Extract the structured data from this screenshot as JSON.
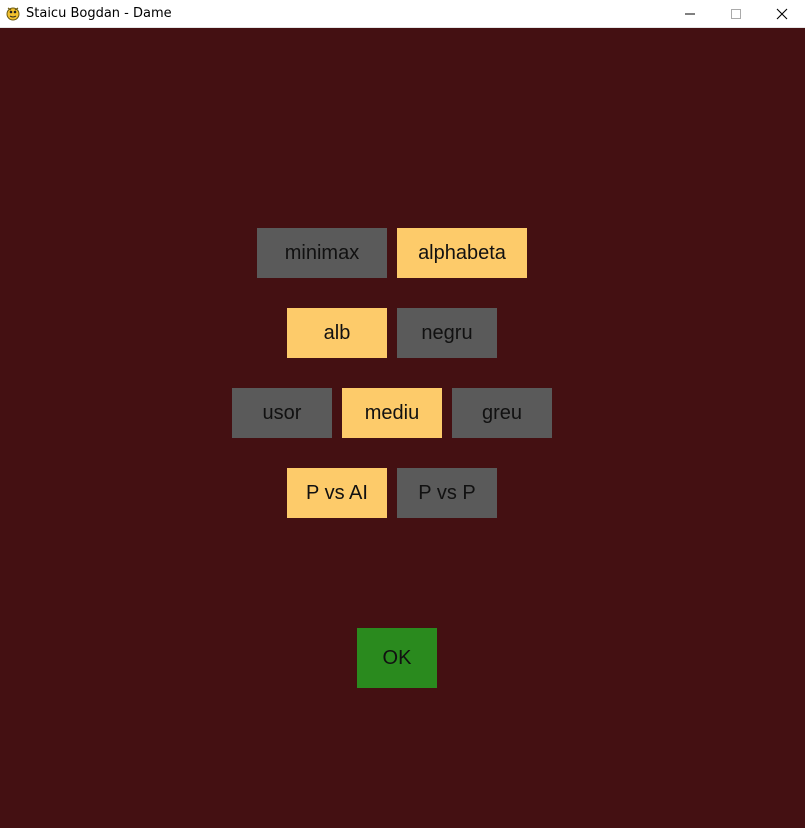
{
  "window": {
    "title": "Staicu Bogdan - Dame",
    "icon": "pygame-snake-icon"
  },
  "colors": {
    "background": "#441012",
    "selected": "#fdcb6a",
    "unselected": "#5a5a5a",
    "ok": "#2a8a1e"
  },
  "menu": {
    "algorithm": {
      "options": [
        "minimax",
        "alphabeta"
      ],
      "selected": "alphabeta"
    },
    "color": {
      "options": [
        "alb",
        "negru"
      ],
      "selected": "alb"
    },
    "difficulty": {
      "options": [
        "usor",
        "mediu",
        "greu"
      ],
      "selected": "mediu"
    },
    "mode": {
      "options": [
        "P vs AI",
        "P vs P"
      ],
      "selected": "P vs AI"
    },
    "ok_label": "OK"
  }
}
